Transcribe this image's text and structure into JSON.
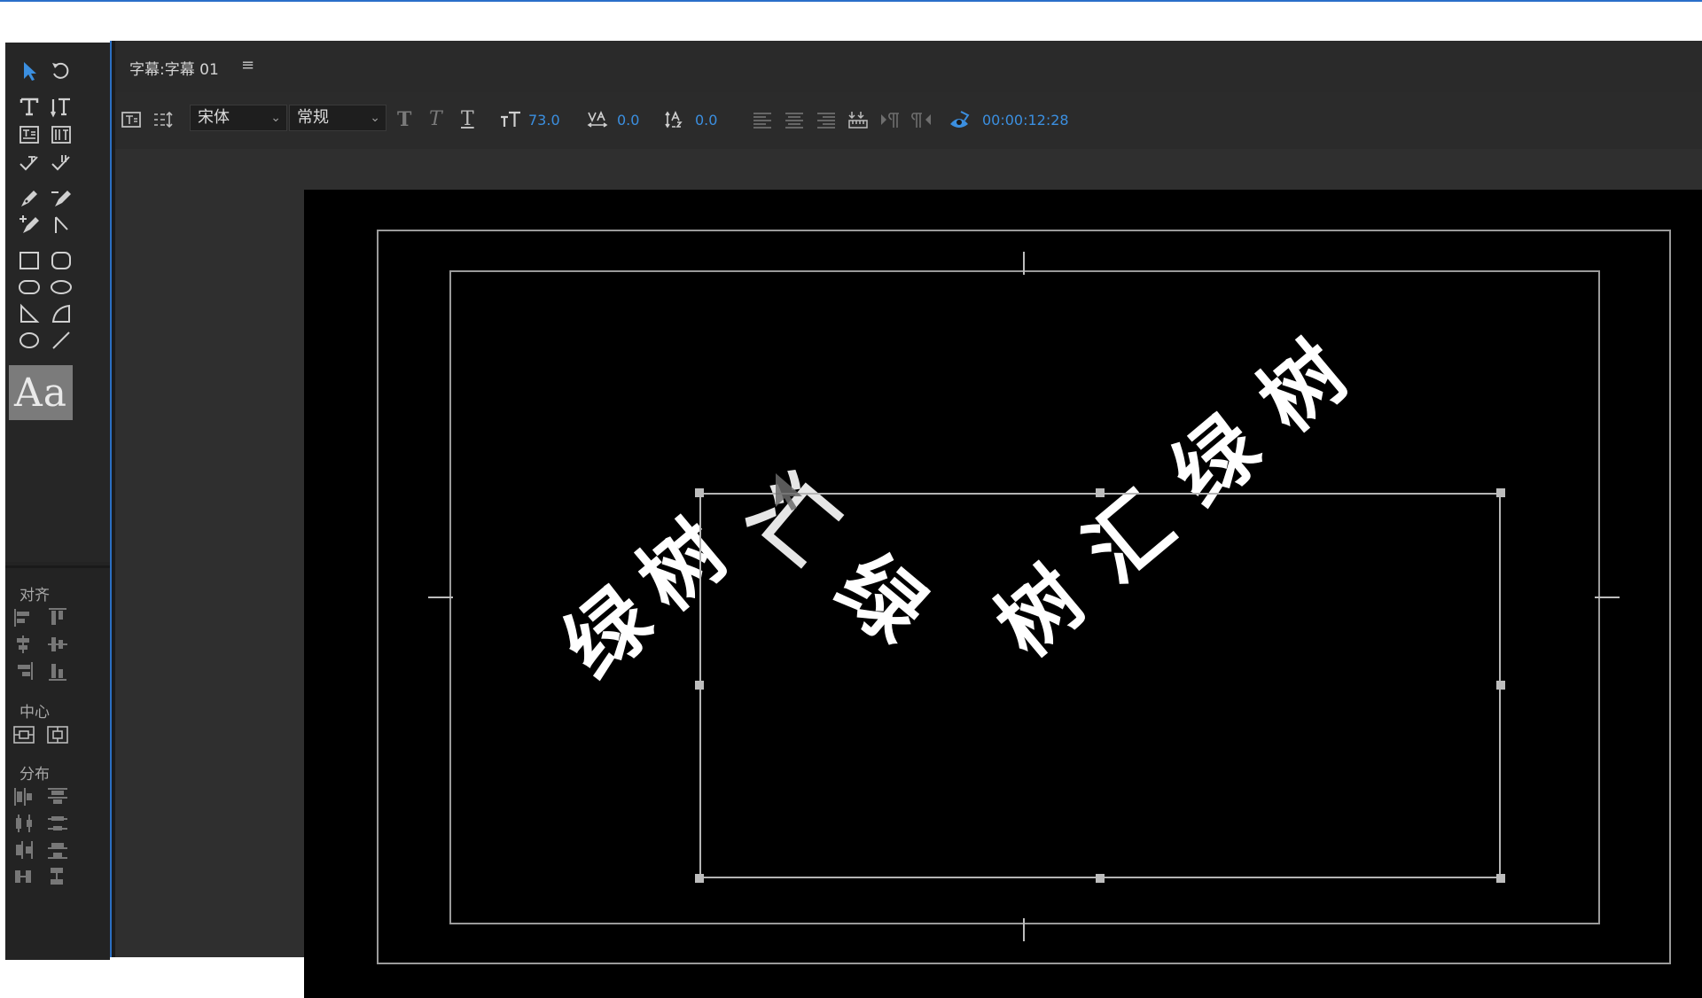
{
  "panel": {
    "title": "字幕:字幕 01",
    "menu_icon": "hamburger-menu-icon"
  },
  "toolbar": {
    "font_family": "宋体",
    "font_style": "常规",
    "font_size": "73.0",
    "kerning": "0.0",
    "leading": "0.0",
    "timecode": "00:00:12:28",
    "accent_color": "#3b8fe0"
  },
  "toolbox": {
    "style_swatch_label": "Aa",
    "align_label": "对齐",
    "center_label": "中心",
    "distribute_label": "分布"
  },
  "canvas": {
    "text_chars": [
      "绿",
      "树",
      "汇",
      "绿",
      "树",
      "汇",
      "绿",
      "树"
    ]
  }
}
